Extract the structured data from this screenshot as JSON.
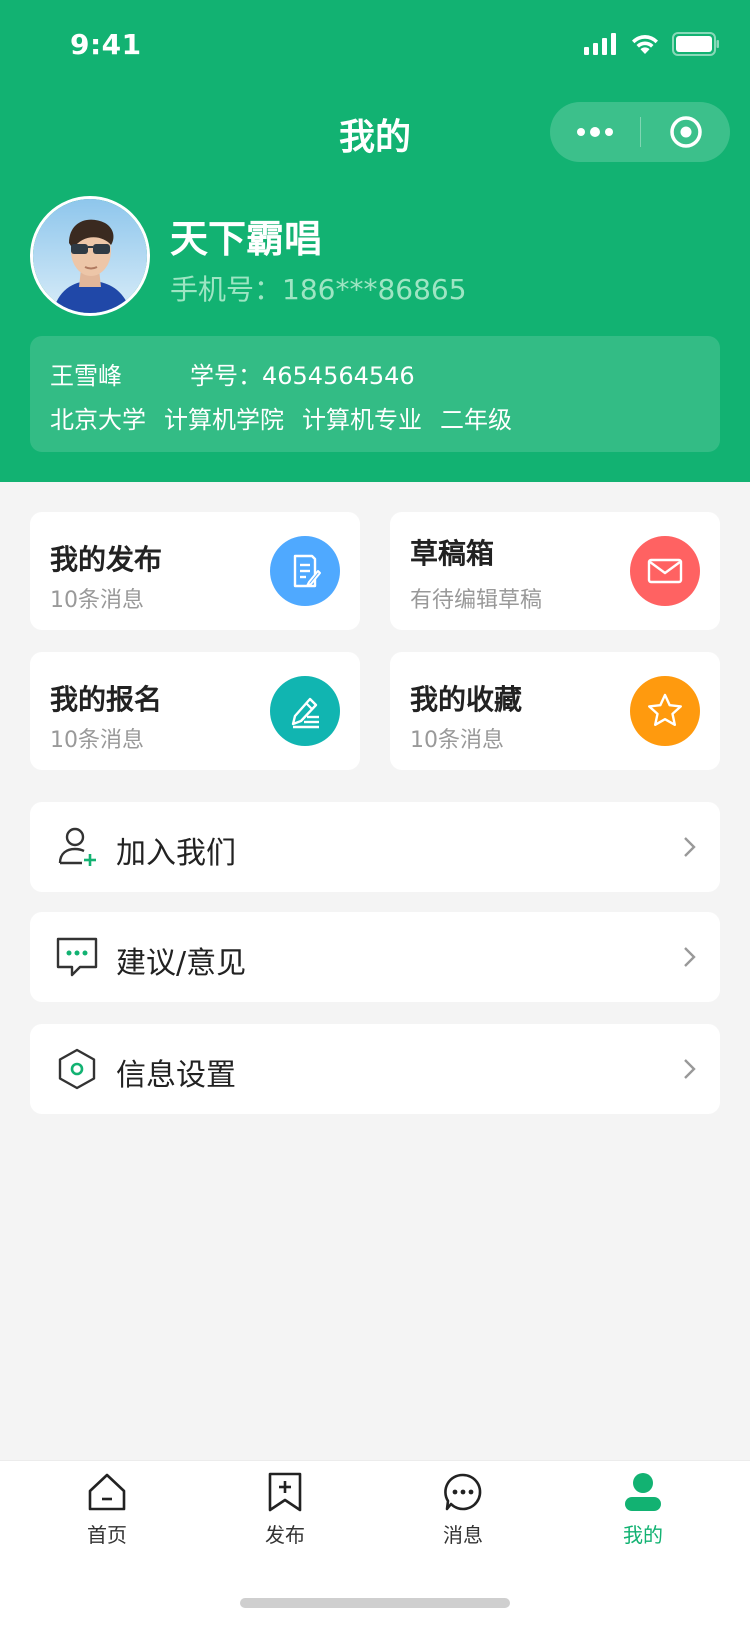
{
  "status_bar": {
    "time": "9:41"
  },
  "nav": {
    "title": "我的"
  },
  "profile": {
    "username": "天下霸唱",
    "phone_label": "手机号：",
    "phone": "186***86865",
    "real_name": "王雪峰",
    "student_id_label": "学号：",
    "student_id": "4654564546",
    "university": "北京大学",
    "college": "计算机学院",
    "major": "计算机专业",
    "grade": "二年级"
  },
  "cards": [
    {
      "title": "我的发布",
      "sub": "10条消息",
      "icon": "document-edit-icon",
      "color": "#4fa9ff"
    },
    {
      "title": "草稿箱",
      "sub": "有待编辑草稿",
      "icon": "envelope-icon",
      "color": "#ff6262"
    },
    {
      "title": "我的报名",
      "sub": "10条消息",
      "icon": "pen-list-icon",
      "color": "#11b5b1"
    },
    {
      "title": "我的收藏",
      "sub": "10条消息",
      "icon": "star-icon",
      "color": "#ff9a0e"
    }
  ],
  "menu": [
    {
      "label": "加入我们",
      "icon": "add-user-icon"
    },
    {
      "label": "建议/意见",
      "icon": "chat-bubble-icon"
    },
    {
      "label": "信息设置",
      "icon": "hexagon-settings-icon"
    }
  ],
  "tabbar": [
    {
      "label": "首页",
      "icon": "home-icon"
    },
    {
      "label": "发布",
      "icon": "bookmark-add-icon"
    },
    {
      "label": "消息",
      "icon": "message-icon"
    },
    {
      "label": "我的",
      "icon": "user-icon",
      "active": true
    }
  ],
  "colors": {
    "brand": "#12b272",
    "background": "#f4f4f4"
  }
}
